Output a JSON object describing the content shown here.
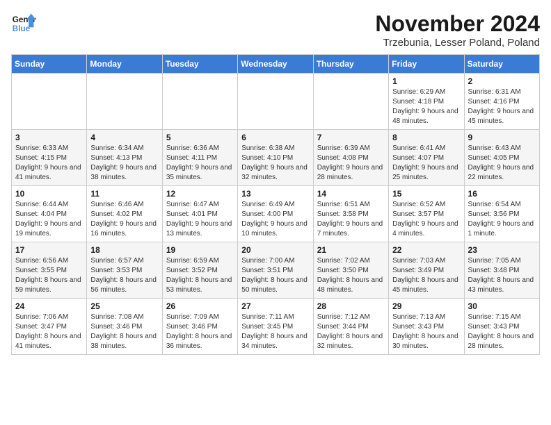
{
  "logo": {
    "text_general": "General",
    "text_blue": "Blue"
  },
  "title": "November 2024",
  "location": "Trzebunia, Lesser Poland, Poland",
  "headers": [
    "Sunday",
    "Monday",
    "Tuesday",
    "Wednesday",
    "Thursday",
    "Friday",
    "Saturday"
  ],
  "weeks": [
    [
      {
        "day": "",
        "info": ""
      },
      {
        "day": "",
        "info": ""
      },
      {
        "day": "",
        "info": ""
      },
      {
        "day": "",
        "info": ""
      },
      {
        "day": "",
        "info": ""
      },
      {
        "day": "1",
        "info": "Sunrise: 6:29 AM\nSunset: 4:18 PM\nDaylight: 9 hours\nand 48 minutes."
      },
      {
        "day": "2",
        "info": "Sunrise: 6:31 AM\nSunset: 4:16 PM\nDaylight: 9 hours\nand 45 minutes."
      }
    ],
    [
      {
        "day": "3",
        "info": "Sunrise: 6:33 AM\nSunset: 4:15 PM\nDaylight: 9 hours\nand 41 minutes."
      },
      {
        "day": "4",
        "info": "Sunrise: 6:34 AM\nSunset: 4:13 PM\nDaylight: 9 hours\nand 38 minutes."
      },
      {
        "day": "5",
        "info": "Sunrise: 6:36 AM\nSunset: 4:11 PM\nDaylight: 9 hours\nand 35 minutes."
      },
      {
        "day": "6",
        "info": "Sunrise: 6:38 AM\nSunset: 4:10 PM\nDaylight: 9 hours\nand 32 minutes."
      },
      {
        "day": "7",
        "info": "Sunrise: 6:39 AM\nSunset: 4:08 PM\nDaylight: 9 hours\nand 28 minutes."
      },
      {
        "day": "8",
        "info": "Sunrise: 6:41 AM\nSunset: 4:07 PM\nDaylight: 9 hours\nand 25 minutes."
      },
      {
        "day": "9",
        "info": "Sunrise: 6:43 AM\nSunset: 4:05 PM\nDaylight: 9 hours\nand 22 minutes."
      }
    ],
    [
      {
        "day": "10",
        "info": "Sunrise: 6:44 AM\nSunset: 4:04 PM\nDaylight: 9 hours\nand 19 minutes."
      },
      {
        "day": "11",
        "info": "Sunrise: 6:46 AM\nSunset: 4:02 PM\nDaylight: 9 hours\nand 16 minutes."
      },
      {
        "day": "12",
        "info": "Sunrise: 6:47 AM\nSunset: 4:01 PM\nDaylight: 9 hours\nand 13 minutes."
      },
      {
        "day": "13",
        "info": "Sunrise: 6:49 AM\nSunset: 4:00 PM\nDaylight: 9 hours\nand 10 minutes."
      },
      {
        "day": "14",
        "info": "Sunrise: 6:51 AM\nSunset: 3:58 PM\nDaylight: 9 hours\nand 7 minutes."
      },
      {
        "day": "15",
        "info": "Sunrise: 6:52 AM\nSunset: 3:57 PM\nDaylight: 9 hours\nand 4 minutes."
      },
      {
        "day": "16",
        "info": "Sunrise: 6:54 AM\nSunset: 3:56 PM\nDaylight: 9 hours\nand 1 minute."
      }
    ],
    [
      {
        "day": "17",
        "info": "Sunrise: 6:56 AM\nSunset: 3:55 PM\nDaylight: 8 hours\nand 59 minutes."
      },
      {
        "day": "18",
        "info": "Sunrise: 6:57 AM\nSunset: 3:53 PM\nDaylight: 8 hours\nand 56 minutes."
      },
      {
        "day": "19",
        "info": "Sunrise: 6:59 AM\nSunset: 3:52 PM\nDaylight: 8 hours\nand 53 minutes."
      },
      {
        "day": "20",
        "info": "Sunrise: 7:00 AM\nSunset: 3:51 PM\nDaylight: 8 hours\nand 50 minutes."
      },
      {
        "day": "21",
        "info": "Sunrise: 7:02 AM\nSunset: 3:50 PM\nDaylight: 8 hours\nand 48 minutes."
      },
      {
        "day": "22",
        "info": "Sunrise: 7:03 AM\nSunset: 3:49 PM\nDaylight: 8 hours\nand 45 minutes."
      },
      {
        "day": "23",
        "info": "Sunrise: 7:05 AM\nSunset: 3:48 PM\nDaylight: 8 hours\nand 43 minutes."
      }
    ],
    [
      {
        "day": "24",
        "info": "Sunrise: 7:06 AM\nSunset: 3:47 PM\nDaylight: 8 hours\nand 41 minutes."
      },
      {
        "day": "25",
        "info": "Sunrise: 7:08 AM\nSunset: 3:46 PM\nDaylight: 8 hours\nand 38 minutes."
      },
      {
        "day": "26",
        "info": "Sunrise: 7:09 AM\nSunset: 3:46 PM\nDaylight: 8 hours\nand 36 minutes."
      },
      {
        "day": "27",
        "info": "Sunrise: 7:11 AM\nSunset: 3:45 PM\nDaylight: 8 hours\nand 34 minutes."
      },
      {
        "day": "28",
        "info": "Sunrise: 7:12 AM\nSunset: 3:44 PM\nDaylight: 8 hours\nand 32 minutes."
      },
      {
        "day": "29",
        "info": "Sunrise: 7:13 AM\nSunset: 3:43 PM\nDaylight: 8 hours\nand 30 minutes."
      },
      {
        "day": "30",
        "info": "Sunrise: 7:15 AM\nSunset: 3:43 PM\nDaylight: 8 hours\nand 28 minutes."
      }
    ]
  ]
}
